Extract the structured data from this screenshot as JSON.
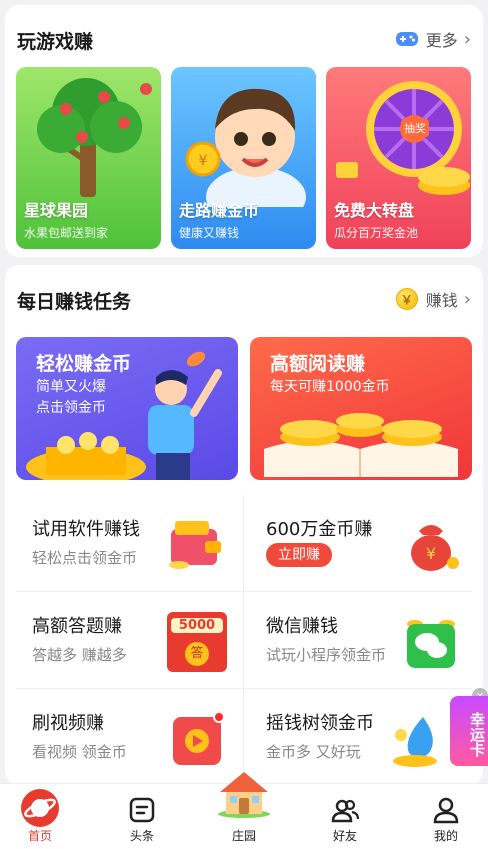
{
  "games": {
    "title": "玩游戏赚",
    "more_label": "更多",
    "tiles": [
      {
        "title": "星球果园",
        "subtitle": "水果包邮送到家"
      },
      {
        "title": "走路赚金币",
        "subtitle": "健康又赚钱"
      },
      {
        "title": "免费大转盘",
        "subtitle": "瓜分百万奖金池"
      }
    ],
    "wheel_badge": "抽奖"
  },
  "tasks": {
    "title": "每日赚钱任务",
    "more_label": "赚钱",
    "coin_glyph": "￥",
    "promos": [
      {
        "title": "轻松赚金币",
        "line1": "简单又火爆",
        "line2": "点击领金币"
      },
      {
        "title": "高额阅读赚",
        "line1": "每天可赚1000金币"
      }
    ],
    "items": [
      {
        "title": "试用软件赚钱",
        "subtitle": "轻松点击领金币"
      },
      {
        "title": "600万金币赚",
        "button": "立即赚"
      },
      {
        "title": "高额答题赚",
        "subtitle": "答越多  赚越多",
        "badge": "5000",
        "badge2": "答"
      },
      {
        "title": "微信赚钱",
        "subtitle": "试玩小程序领金币"
      },
      {
        "title": "刷视频赚",
        "subtitle": "看视频  领金币"
      },
      {
        "title": "摇钱树领金币",
        "subtitle": "金币多  又好玩"
      }
    ],
    "float_label": "幸运卡"
  },
  "tabbar": {
    "items": [
      {
        "label": "首页",
        "icon": "planet-icon"
      },
      {
        "label": "头条",
        "icon": "news-icon"
      },
      {
        "label": "庄园",
        "icon": "house-icon"
      },
      {
        "label": "好友",
        "icon": "friends-icon"
      },
      {
        "label": "我的",
        "icon": "profile-icon"
      }
    ],
    "active_color": "#e83a2e"
  }
}
